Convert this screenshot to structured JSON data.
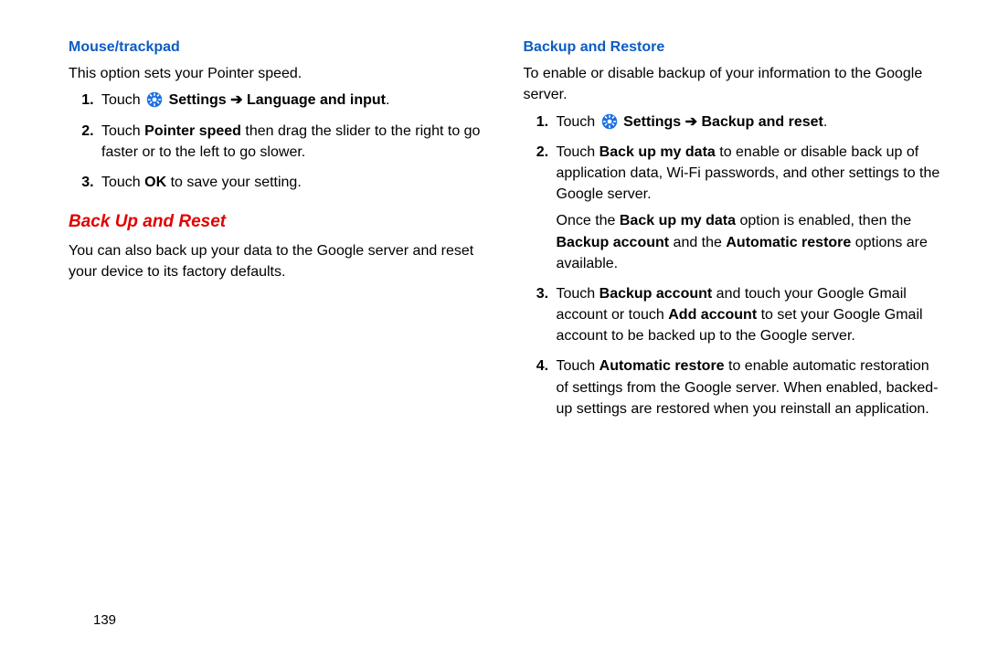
{
  "page_number": "139",
  "left": {
    "h1": "Mouse/trackpad",
    "intro": "This option sets your Pointer speed.",
    "steps": [
      {
        "pre": "Touch ",
        "icon": "settings-gear-icon",
        "boldpath": " Settings ➔ Language and input",
        "post": "."
      },
      {
        "runs": [
          {
            "t": "Touch "
          },
          {
            "t": "Pointer speed",
            "b": true
          },
          {
            "t": " then drag the slider to the right to go faster or to the left to go slower."
          }
        ]
      },
      {
        "runs": [
          {
            "t": "Touch "
          },
          {
            "t": "OK",
            "b": true
          },
          {
            "t": " to save your setting."
          }
        ]
      }
    ],
    "h2": "Back Up and Reset",
    "body2": "You can also back up your data to the Google server and reset your device to its factory defaults."
  },
  "right": {
    "h1": "Backup and Restore",
    "intro": "To enable or disable backup of your information to the Google server.",
    "steps": [
      {
        "pre": "Touch ",
        "icon": "settings-gear-icon",
        "boldpath": " Settings ➔ Backup and reset",
        "post": "."
      },
      {
        "runs": [
          {
            "t": "Touch "
          },
          {
            "t": "Back up my data",
            "b": true
          },
          {
            "t": " to enable or disable back up of application data, Wi-Fi passwords, and other settings to the Google server."
          }
        ],
        "follow": [
          {
            "t": "Once the "
          },
          {
            "t": "Back up my data",
            "b": true
          },
          {
            "t": " option is enabled, then the "
          },
          {
            "t": "Backup account",
            "b": true
          },
          {
            "t": " and the "
          },
          {
            "t": "Automatic restore",
            "b": true
          },
          {
            "t": " options are available."
          }
        ]
      },
      {
        "runs": [
          {
            "t": "Touch "
          },
          {
            "t": "Backup account",
            "b": true
          },
          {
            "t": " and touch your Google Gmail account or touch "
          },
          {
            "t": "Add account",
            "b": true
          },
          {
            "t": " to set your Google Gmail account to be backed up to the Google server."
          }
        ]
      },
      {
        "runs": [
          {
            "t": "Touch "
          },
          {
            "t": "Automatic restore",
            "b": true
          },
          {
            "t": " to enable automatic restoration of settings from the Google server. When enabled, backed-up settings are restored when you reinstall an application."
          }
        ]
      }
    ]
  }
}
